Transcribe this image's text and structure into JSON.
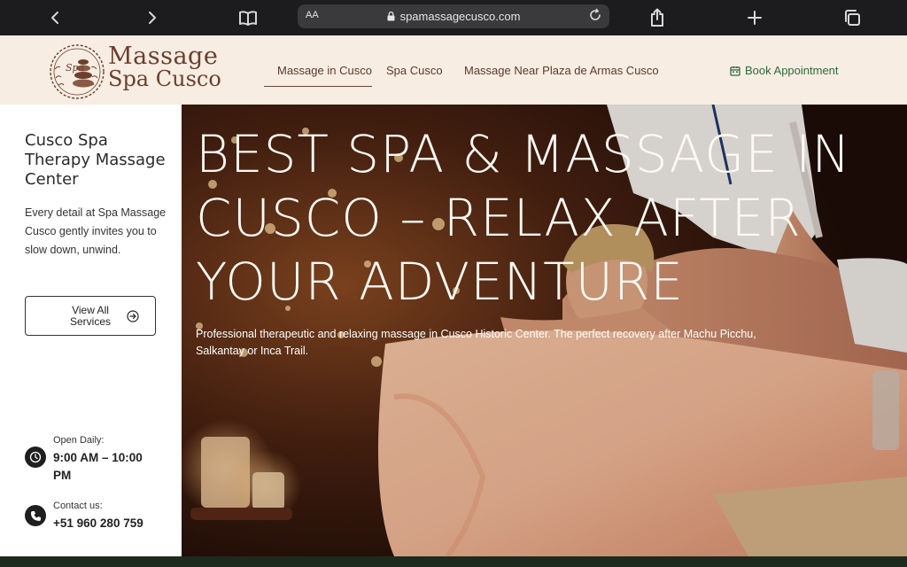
{
  "browser": {
    "url": "spamassagecusco.com",
    "text_size_label": "AA"
  },
  "logo": {
    "emblem_text": "Spa",
    "line1": "Massage",
    "line2": "Spa Cusco"
  },
  "nav": {
    "items": [
      {
        "label": "Massage in Cusco",
        "active": true
      },
      {
        "label": "Spa Cusco",
        "active": false
      },
      {
        "label": "Massage Near Plaza de Armas Cusco",
        "active": false
      }
    ],
    "book_label": "Book Appointment"
  },
  "sidebar": {
    "title": "Cusco Spa Therapy Massage Center",
    "description": "Every detail at Spa Massage Cusco gently invites you to slow down, unwind.",
    "button_label": "View All Services",
    "hours_label": "Open Daily:",
    "hours_value": "9:00 AM – 10:00 PM",
    "contact_label": "Contact us:",
    "contact_value": "+51 960 280 759"
  },
  "hero": {
    "title": "BEST SPA & MASSAGE IN CUSCO – RELAX AFTER YOUR ADVENTURE",
    "subtitle": "Professional therapeutic and relaxing massage in Cusco Historic Center. The perfect recovery after Machu Picchu, Salkantay or Inca Trail."
  },
  "colors": {
    "header_bg": "#f7ede2",
    "brand_brown": "#6b3f2e",
    "book_green": "#2d6a3e",
    "browser_bg": "#1c1c1e"
  }
}
